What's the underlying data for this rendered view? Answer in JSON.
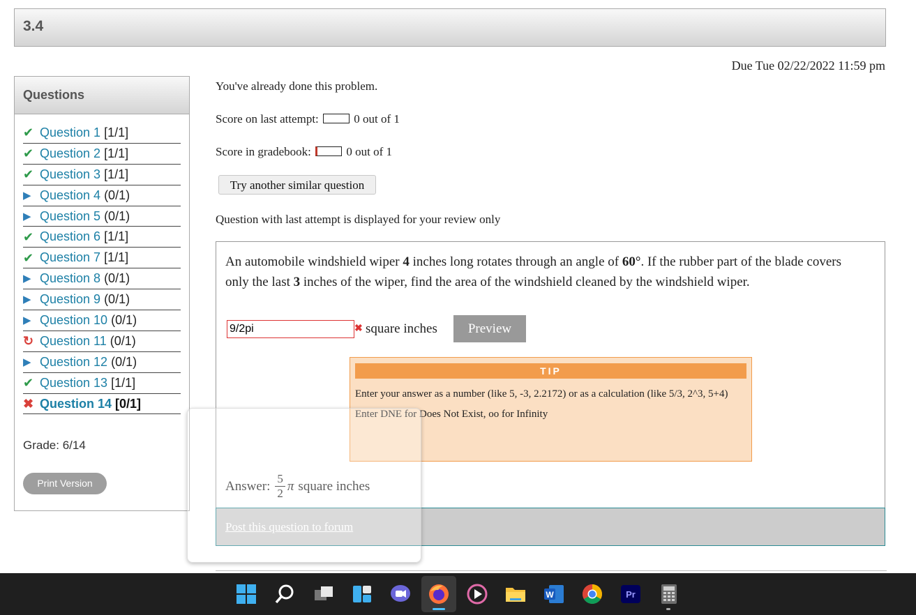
{
  "page": {
    "title": "3.4",
    "due": "Due Tue 02/22/2022 11:59 pm"
  },
  "sidebar": {
    "header": "Questions",
    "questions": [
      {
        "label": "Question 1",
        "score": "[1/1]",
        "status": "correct"
      },
      {
        "label": "Question 2",
        "score": "[1/1]",
        "status": "correct"
      },
      {
        "label": "Question 3",
        "score": "[1/1]",
        "status": "correct"
      },
      {
        "label": "Question 4",
        "score": "(0/1)",
        "status": "unattempted"
      },
      {
        "label": "Question 5",
        "score": "(0/1)",
        "status": "unattempted"
      },
      {
        "label": "Question 6",
        "score": "[1/1]",
        "status": "correct"
      },
      {
        "label": "Question 7",
        "score": "[1/1]",
        "status": "correct"
      },
      {
        "label": "Question 8",
        "score": "(0/1)",
        "status": "unattempted"
      },
      {
        "label": "Question 9",
        "score": "(0/1)",
        "status": "unattempted"
      },
      {
        "label": "Question 10",
        "score": "(0/1)",
        "status": "unattempted"
      },
      {
        "label": "Question 11",
        "score": "(0/1)",
        "status": "retry"
      },
      {
        "label": "Question 12",
        "score": "(0/1)",
        "status": "unattempted"
      },
      {
        "label": "Question 13",
        "score": "[1/1]",
        "status": "correct"
      },
      {
        "label": "Question 14",
        "score": "[0/1]",
        "status": "incorrect",
        "current": true
      }
    ],
    "grade": "Grade: 6/14",
    "print_button": "Print Version"
  },
  "main": {
    "already_done": "You've already done this problem.",
    "last_attempt_label": "Score on last attempt:",
    "last_attempt_value": "0 out of 1",
    "gradebook_label": "Score in gradebook:",
    "gradebook_value": "0 out of 1",
    "try_button": "Try another similar question",
    "review_note": "Question with last attempt is displayed for your review only"
  },
  "question": {
    "text_1": "An automobile windshield wiper ",
    "length": "4",
    "text_2": " inches long rotates through an angle of ",
    "angle": "60°",
    "text_3": ". If the rubber part of the blade covers only the last ",
    "blade": "3",
    "text_4": " inches of the wiper, find the area of the windshield cleaned by the windshield wiper.",
    "input_value": "9/2pi",
    "units": "square inches",
    "preview_button": "Preview"
  },
  "tip": {
    "header": "TIP",
    "line1": "Enter your answer as a number (like 5, -3, 2.2172) or as a calculation (like 5/3, 2^3, 5+4)",
    "line2": "Enter DNE for Does Not Exist, oo for Infinity"
  },
  "answer": {
    "label": "Answer:",
    "numerator": "5",
    "denominator": "2",
    "symbol": "π",
    "units": "square inches"
  },
  "forum_link": "Post this question to forum",
  "taskbar": {
    "icons": [
      "windows-start-icon",
      "search-icon",
      "task-view-icon",
      "widgets-icon",
      "chat-icon",
      "firefox-icon",
      "media-player-icon",
      "file-explorer-icon",
      "word-icon",
      "chrome-icon",
      "premiere-pro-icon",
      "calculator-icon"
    ],
    "word_letter": "W",
    "premiere_letters": "Pr"
  },
  "colors": {
    "link": "#1d80a6",
    "correct": "#2e9a4a",
    "incorrect": "#d9403a",
    "tip_header": "#f29c4c",
    "tip_bg": "#fbdfc3"
  }
}
